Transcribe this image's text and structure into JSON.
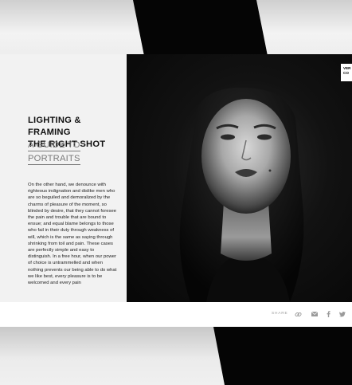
{
  "article": {
    "title_lines": [
      "Lighting & Framing",
      "the right shot"
    ],
    "subtitle_lines": [
      "A guide to",
      "portraits"
    ],
    "body": "On the other hand, we denounce with righteous indignation and dislike men who are so beguiled and demoralized by the charms of pleasure of the moment, so blinded by desire, that they cannot foresee the pain and trouble that are bound to ensue; and equal blame belongs to those who fail in their duty through weakness of will, which is the same as saying through shrinking from toil and pain. These cases are perfectly simple and easy to distinguish. In a free hour, when our power of choice is untrammelled and when nothing prevents our being able to do what we like best, every pleasure is to be welcomed and every pain"
  },
  "photo": {
    "badge_lines": [
      "VER",
      "CO"
    ]
  },
  "footer": {
    "share_label": "SHARE",
    "icons": [
      "link-icon",
      "mail-icon",
      "facebook-icon",
      "twitter-icon"
    ]
  },
  "colors": {
    "background": "#e2e2e2",
    "text_panel": "#f2f2f2",
    "photo_dark": "#070707",
    "subtitle": "#7a7a7a"
  }
}
